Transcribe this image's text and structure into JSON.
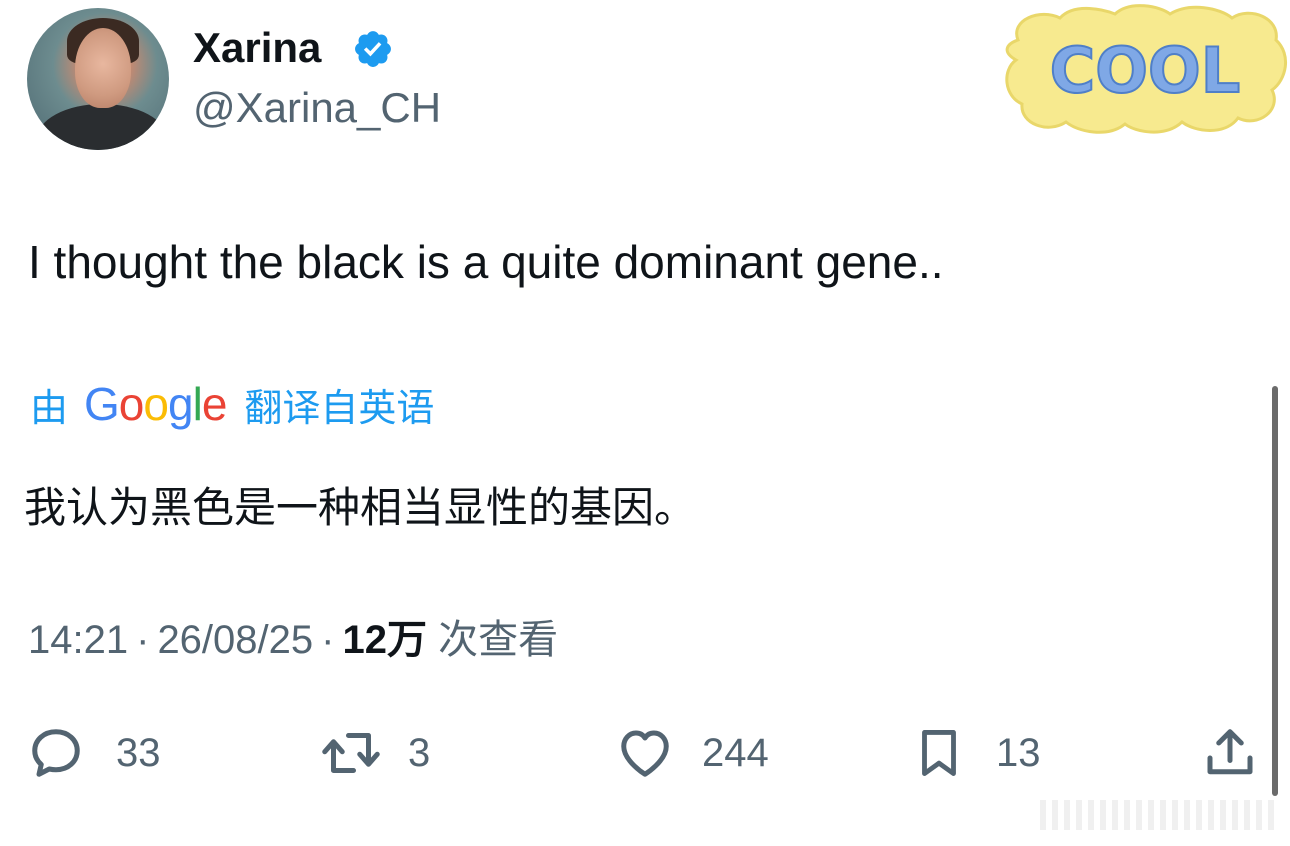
{
  "author": {
    "display_name": "Xarina",
    "handle": "@Xarina_CH",
    "verified_icon": "verified-badge-icon"
  },
  "sticker": {
    "text": "COOL"
  },
  "tweet": {
    "text": "I thought the black is a quite dominant gene..",
    "translation_prefix": "由",
    "translation_provider": "Google",
    "translation_suffix": "翻译自英语",
    "translation": "我认为黑色是一种相当显性的基因。"
  },
  "meta": {
    "time": "14:21",
    "date": "26/08/25",
    "views_count": "12万",
    "views_label": "次查看",
    "separator": "·"
  },
  "actions": {
    "reply_count": "33",
    "retweet_count": "3",
    "like_count": "244",
    "bookmark_count": "13"
  },
  "colors": {
    "accent": "#1d9bf0",
    "text": "#0f1419",
    "secondary": "#536471"
  }
}
